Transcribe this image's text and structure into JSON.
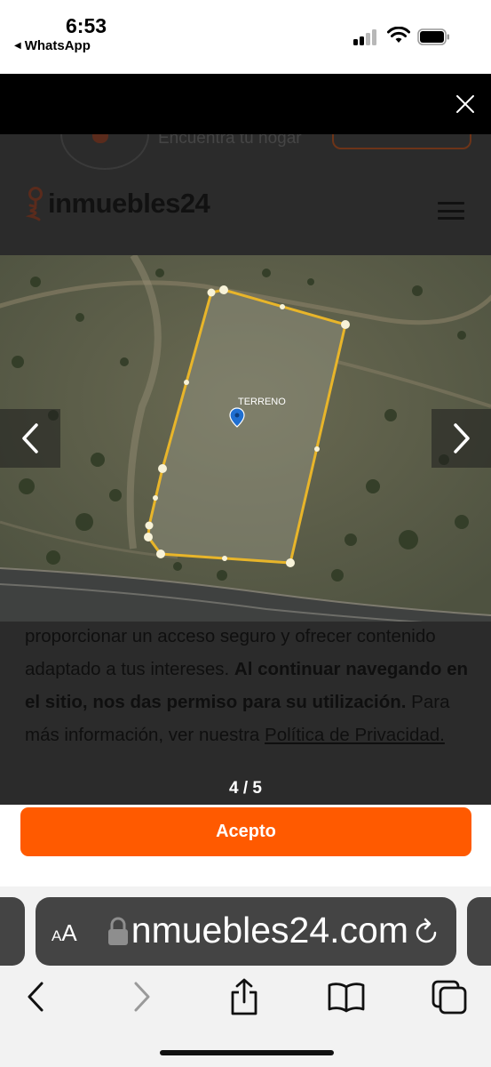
{
  "status_bar": {
    "time": "6:53",
    "back_app": "WhatsApp",
    "back_arrow": "◀"
  },
  "gallery": {
    "close_icon": "close-icon",
    "counter": "4 / 5",
    "photo_label": "TERRENO",
    "prev_icon": "chevron-left-icon",
    "next_icon": "chevron-right-icon"
  },
  "site": {
    "tagline": "Encuentra tu hogar",
    "logo_text": "inmuebles24",
    "brand_color": "#ff5a00"
  },
  "cookie_banner": {
    "text_plain": "proporcionar un acceso seguro y ofrecer contenido adaptado a tus intereses. ",
    "text_bold": "Al continuar navegando en el sitio, nos das permiso para su utilización.",
    "text_more": " Para más información, ver nuestra ",
    "policy_link": "Política de Privacidad.",
    "accept_label": "Acepto"
  },
  "browser": {
    "text_size_small": "A",
    "text_size_large": "A",
    "url": "inmuebles24.com",
    "toolbar": [
      "back-icon",
      "forward-icon",
      "share-icon",
      "bookmarks-icon",
      "tabs-icon"
    ]
  }
}
